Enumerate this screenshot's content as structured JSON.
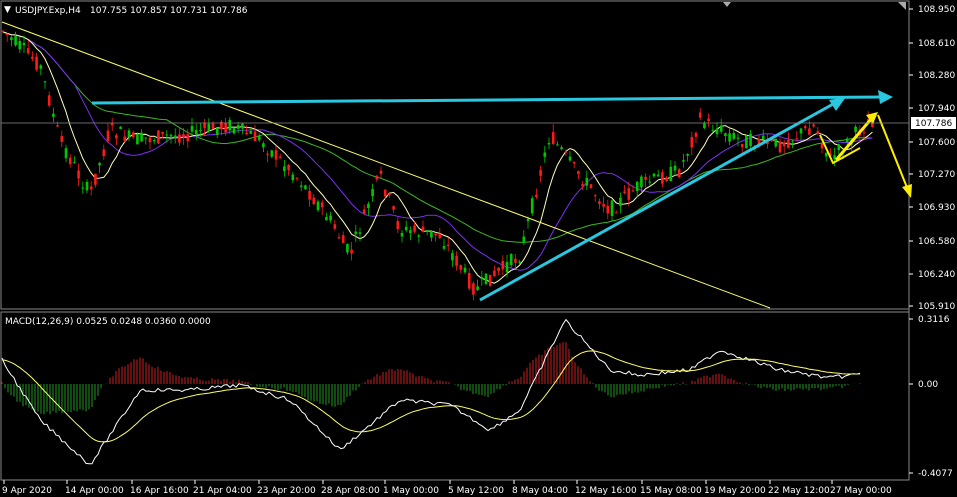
{
  "window": {
    "symbol_label": "USDJPY.Exp,H4",
    "ohlc": "107.755 107.857 107.731 107.786",
    "dropdown_glyph": "▼"
  },
  "price_panel": {
    "axis_ticks": [
      "108.950",
      "108.610",
      "108.280",
      "107.940",
      "107.600",
      "107.270",
      "106.930",
      "106.580",
      "106.240",
      "105.910"
    ],
    "current_price": "107.786"
  },
  "macd_panel": {
    "label": "MACD(12,26,9) 0.0525 0.0248 0.0360 0.0000",
    "axis_ticks": [
      "0.3116",
      "0.00",
      "-0.4077"
    ]
  },
  "time_axis": {
    "labels": [
      "9 Apr 2020",
      "14 Apr 00:00",
      "16 Apr 16:00",
      "21 Apr 04:00",
      "23 Apr 20:00",
      "28 Apr 08:00",
      "1 May 00:00",
      "5 May 12:00",
      "8 May 04:00",
      "12 May 16:00",
      "15 May 08:00",
      "19 May 20:00",
      "22 May 12:00",
      "27 May 00:00"
    ]
  },
  "colors": {
    "background": "#000000",
    "axis_text": "#ffffff",
    "bull_candle": "#00c800",
    "bear_candle": "#ff1a1a",
    "trendline_down": "#ffff66",
    "channel_up": "#29c8e0",
    "arrow": "#ffee00",
    "ma_slow": "#3bb81e",
    "ma_mid": "#7b2ff2",
    "ma_fast": "#ffffc0",
    "macd_hist_pos": "#cc2222",
    "macd_hist_neg": "#229922",
    "macd_line": "#ffffff",
    "signal_line": "#ffff66"
  }
}
